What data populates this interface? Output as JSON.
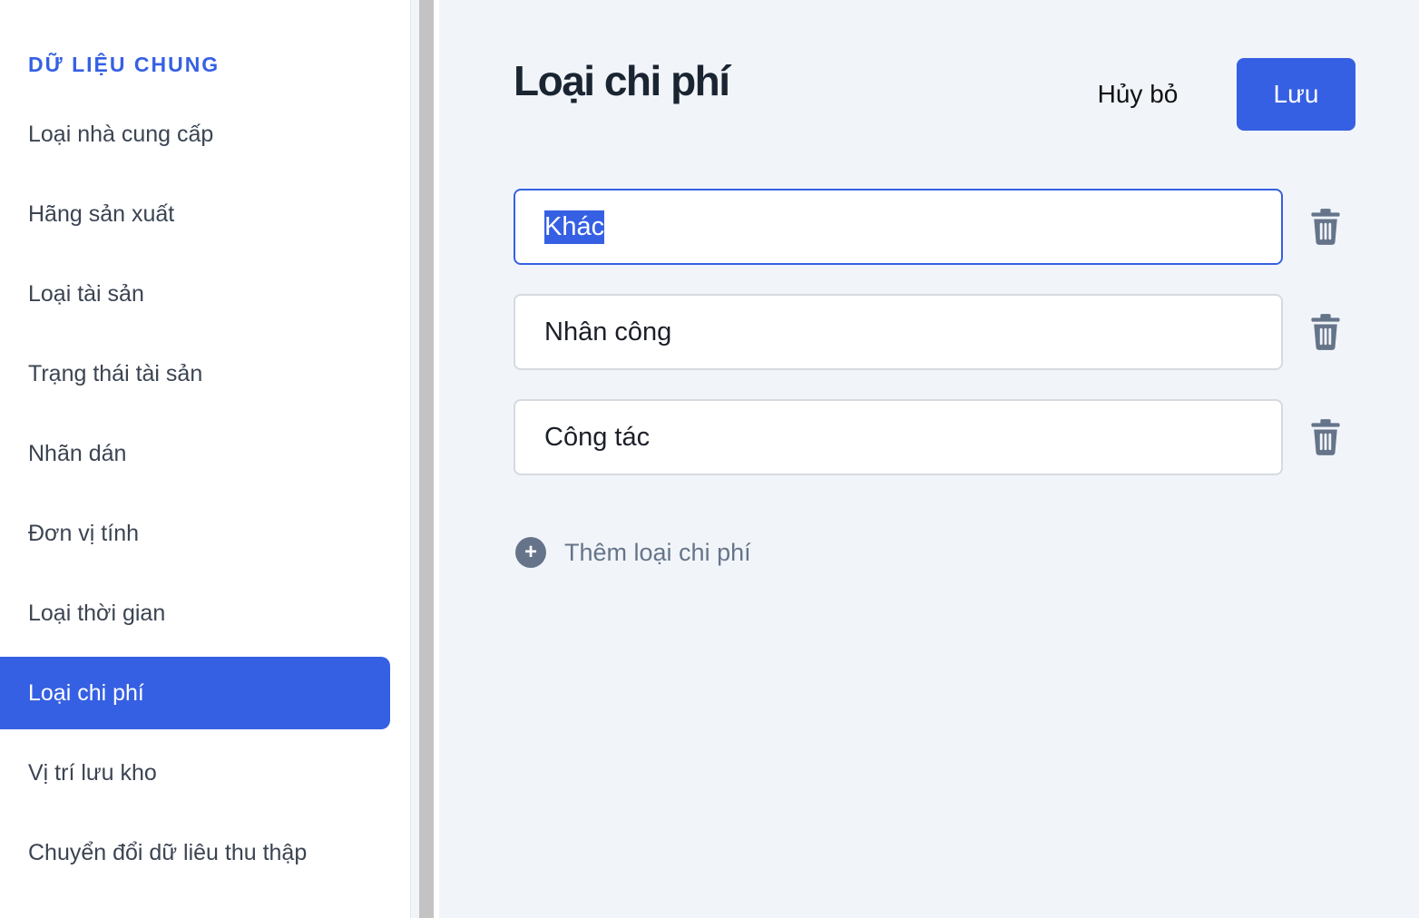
{
  "sidebar": {
    "section_title": "DỮ LIỆU CHUNG",
    "items": [
      {
        "label": "Loại nhà cung cấp"
      },
      {
        "label": "Hãng sản xuất"
      },
      {
        "label": "Loại tài sản"
      },
      {
        "label": "Trạng thái tài sản"
      },
      {
        "label": "Nhãn dán"
      },
      {
        "label": "Đơn vị tính"
      },
      {
        "label": "Loại thời gian"
      },
      {
        "label": "Loại chi phí",
        "active": true
      },
      {
        "label": "Vị trí lưu kho"
      },
      {
        "label": "Chuyển đổi dữ liêu thu thập"
      }
    ]
  },
  "main": {
    "title": "Loại chi phí",
    "cancel_label": "Hủy bỏ",
    "save_label": "Lưu",
    "entries": [
      {
        "value": "Khác",
        "focused": true,
        "selected": true
      },
      {
        "value": "Nhân công"
      },
      {
        "value": "Công tác"
      }
    ],
    "add_label": "Thêm loại chi phí",
    "icons": {
      "delete": "trash-icon",
      "add": "plus-circle-icon"
    }
  },
  "colors": {
    "accent": "#3660e3",
    "background": "#f1f5fa",
    "muted": "#66748a"
  }
}
